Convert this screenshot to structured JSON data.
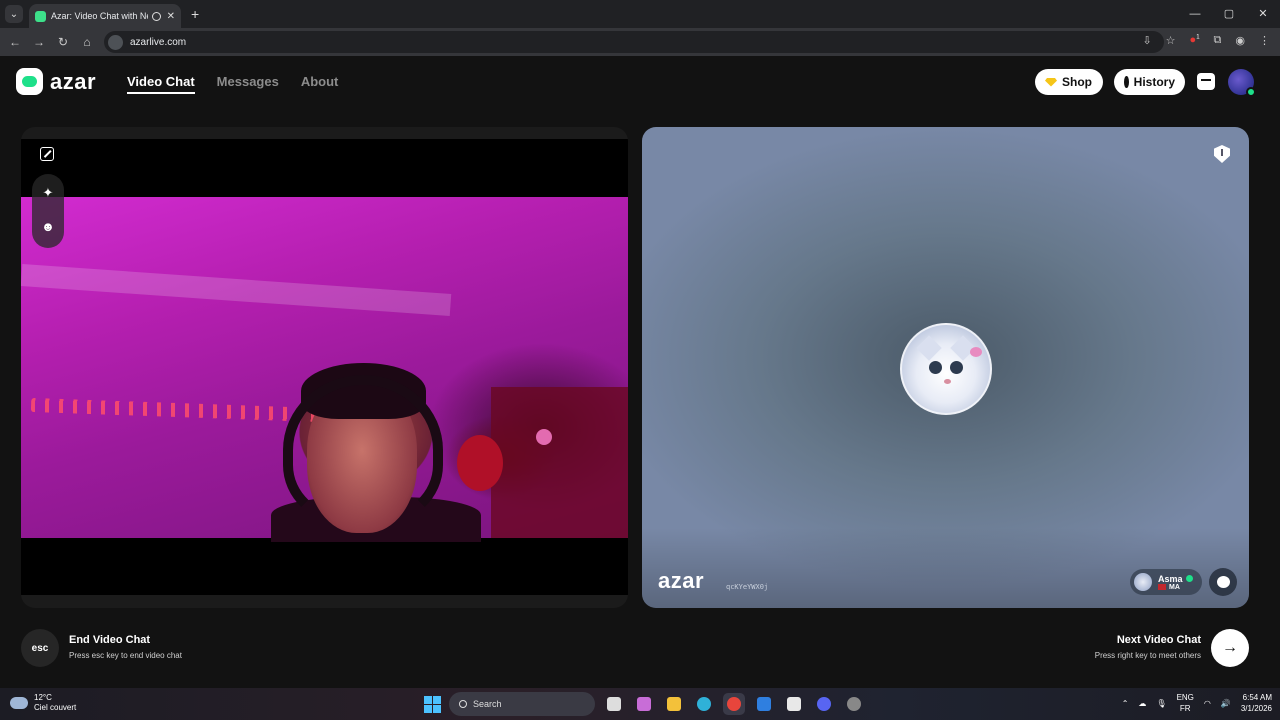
{
  "browser": {
    "tab_title": "Azar: Video Chat with New",
    "tab_close": "✕",
    "new_tab": "+",
    "window_controls": [
      "—",
      "▢",
      "✕"
    ],
    "url": "azarlive.com",
    "ext_badge": "1"
  },
  "nav": {
    "logo_text": "azar",
    "links": [
      {
        "label": "Video Chat",
        "active": true
      },
      {
        "label": "Messages",
        "active": false
      },
      {
        "label": "About",
        "active": false
      }
    ],
    "shop_label": "Shop",
    "history_label": "History"
  },
  "video_right": {
    "watermark": "azar",
    "session_id": "qcKYeYWX0j",
    "peer_name": "Asma",
    "peer_country": "MA"
  },
  "controls": {
    "esc_key_label": "esc",
    "end_title": "End Video Chat",
    "end_hint": "Press esc key to end video chat",
    "next_title": "Next Video Chat",
    "next_hint": "Press right key to meet others",
    "next_arrow": "→"
  },
  "taskbar": {
    "temperature": "12°C",
    "weather": "Ciel couvert",
    "search_label": "Search",
    "lang_top": "ENG",
    "lang_bottom": "FR",
    "time": "6:54 AM",
    "date": "3/1/2026"
  },
  "colors": {
    "accent_green": "#1ee08a",
    "shop_gem": "#f5c518",
    "page_bg": "#121212"
  }
}
